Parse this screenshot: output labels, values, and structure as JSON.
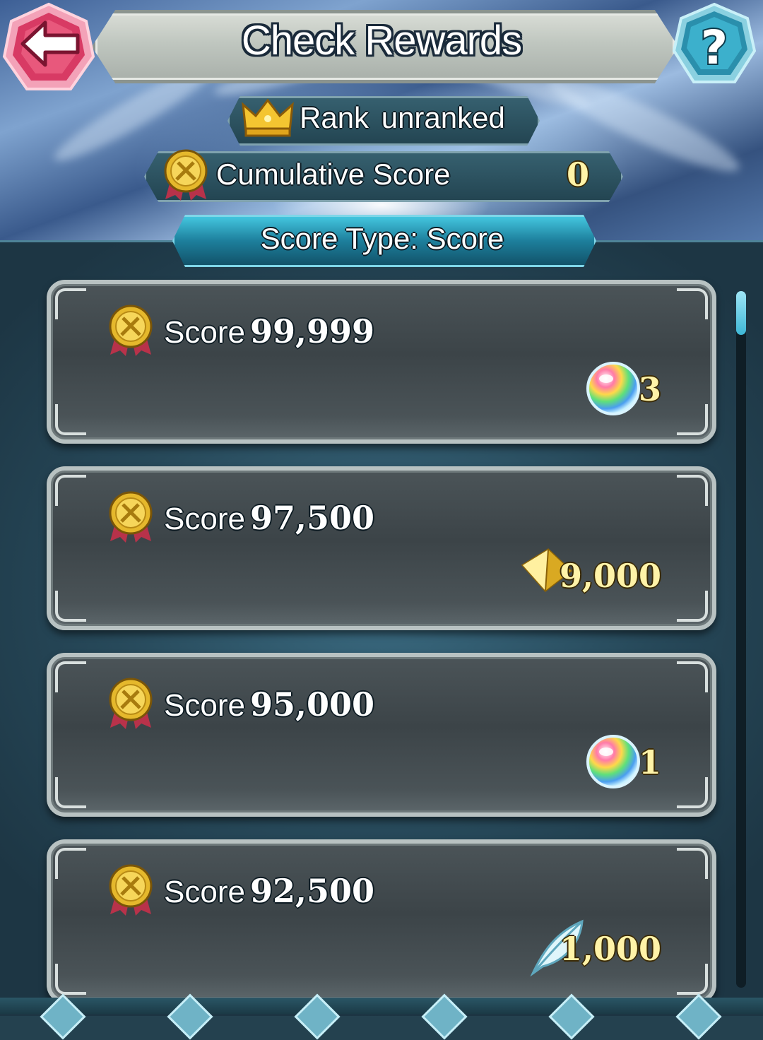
{
  "header": {
    "title": "Check Rewards",
    "back_icon": "back-arrow-icon",
    "help_icon": "question-mark-icon"
  },
  "rank": {
    "label": "Rank  unranked",
    "icon": "crown-icon"
  },
  "cumulative": {
    "label": "Cumulative Score",
    "value": "0",
    "icon": "gold-medal-icon"
  },
  "score_type": {
    "label": "Score Type: Score"
  },
  "rewards": [
    {
      "score_label": "Score",
      "score_value": "99,999",
      "reward_icon": "orb-icon",
      "reward_qty": "3"
    },
    {
      "score_label": "Score",
      "score_value": "97,500",
      "reward_icon": "gold-crystal-icon",
      "reward_qty": "9,000"
    },
    {
      "score_label": "Score",
      "score_value": "95,000",
      "reward_icon": "orb-icon",
      "reward_qty": "1"
    },
    {
      "score_label": "Score",
      "score_value": "92,500",
      "reward_icon": "feather-icon",
      "reward_qty": "1,000"
    }
  ],
  "colors": {
    "accent_blue": "#2fa6c4",
    "gold_text": "#fff3a8",
    "card_bg": "#454e52",
    "back_button": "#e0486e",
    "help_button": "#2aa4c0"
  }
}
